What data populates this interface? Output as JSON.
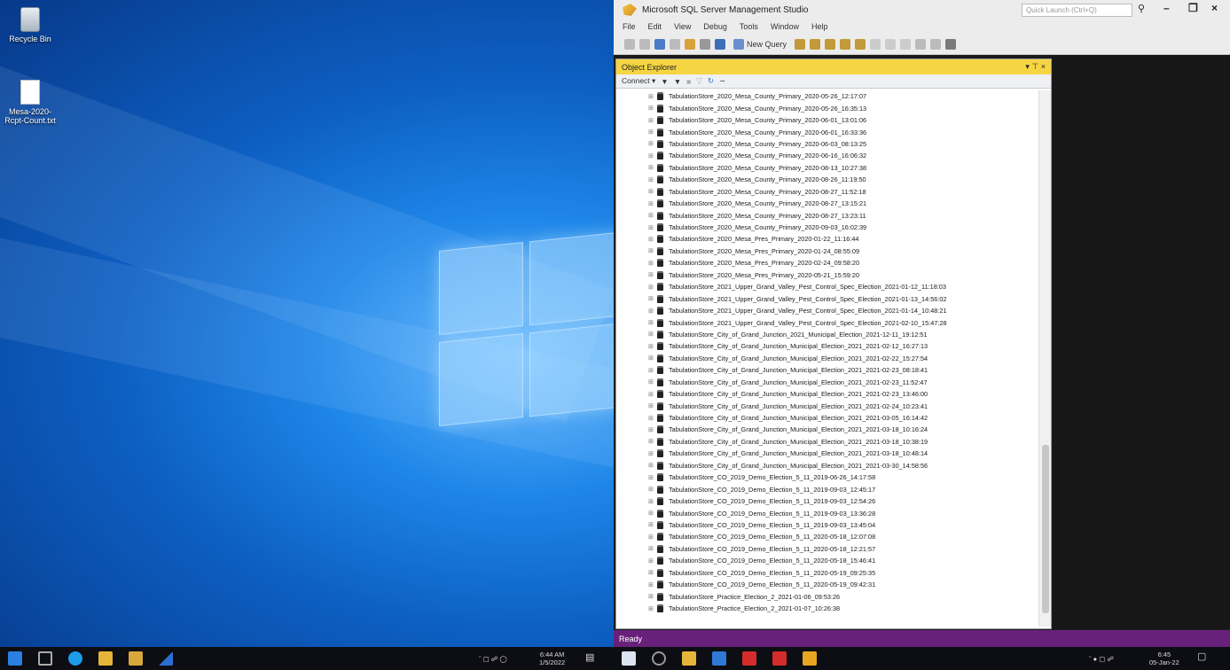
{
  "desktop": {
    "icons": [
      {
        "label": "Recycle Bin",
        "icon": "recycle-bin-icon"
      },
      {
        "label": "Mesa-2020-Rcpt-Count.txt",
        "icon": "text-file-icon"
      }
    ]
  },
  "ssms": {
    "title": "Microsoft SQL Server Management Studio",
    "quick_launch_placeholder": "Quick Launch (Ctrl+Q)",
    "menu": [
      "File",
      "Edit",
      "View",
      "Debug",
      "Tools",
      "Window",
      "Help"
    ],
    "toolbar": {
      "new_query": "New Query"
    },
    "object_explorer": {
      "title": "Object Explorer",
      "pin_controls": "▾ ⊤ ×",
      "connect": "Connect ▾",
      "databases": [
        "TabulationStore_2020_Mesa_County_Primary_2020-05-26_12:17:07",
        "TabulationStore_2020_Mesa_County_Primary_2020-05-26_16:35:13",
        "TabulationStore_2020_Mesa_County_Primary_2020-06-01_13:01:06",
        "TabulationStore_2020_Mesa_County_Primary_2020-06-01_16:33:36",
        "TabulationStore_2020_Mesa_County_Primary_2020-06-03_08:13:25",
        "TabulationStore_2020_Mesa_County_Primary_2020-06-16_16:06:32",
        "TabulationStore_2020_Mesa_County_Primary_2020-08-13_10:27:38",
        "TabulationStore_2020_Mesa_County_Primary_2020-08-26_11:19:50",
        "TabulationStore_2020_Mesa_County_Primary_2020-08-27_11:52:18",
        "TabulationStore_2020_Mesa_County_Primary_2020-08-27_13:15:21",
        "TabulationStore_2020_Mesa_County_Primary_2020-08-27_13:23:11",
        "TabulationStore_2020_Mesa_County_Primary_2020-09-03_16:02:39",
        "TabulationStore_2020_Mesa_Pres_Primary_2020-01-22_11:16:44",
        "TabulationStore_2020_Mesa_Pres_Primary_2020-01-24_08:55:09",
        "TabulationStore_2020_Mesa_Pres_Primary_2020-02-24_09:58:20",
        "TabulationStore_2020_Mesa_Pres_Primary_2020-05-21_15:59:20",
        "TabulationStore_2021_Upper_Grand_Valley_Pest_Control_Spec_Election_2021-01-12_11:18:03",
        "TabulationStore_2021_Upper_Grand_Valley_Pest_Control_Spec_Election_2021-01-13_14:56:02",
        "TabulationStore_2021_Upper_Grand_Valley_Pest_Control_Spec_Election_2021-01-14_10:48:21",
        "TabulationStore_2021_Upper_Grand_Valley_Pest_Control_Spec_Election_2021-02-10_15:47:28",
        "TabulationStore_City_of_Grand_Junction_2021_Municipal_Election_2021-12-11_19:12:51",
        "TabulationStore_City_of_Grand_Junction_Municipal_Election_2021_2021-02-12_16:27:13",
        "TabulationStore_City_of_Grand_Junction_Municipal_Election_2021_2021-02-22_15:27:54",
        "TabulationStore_City_of_Grand_Junction_Municipal_Election_2021_2021-02-23_08:18:41",
        "TabulationStore_City_of_Grand_Junction_Municipal_Election_2021_2021-02-23_11:52:47",
        "TabulationStore_City_of_Grand_Junction_Municipal_Election_2021_2021-02-23_13:46:00",
        "TabulationStore_City_of_Grand_Junction_Municipal_Election_2021_2021-02-24_10:23:41",
        "TabulationStore_City_of_Grand_Junction_Municipal_Election_2021_2021-03-05_16:14:42",
        "TabulationStore_City_of_Grand_Junction_Municipal_Election_2021_2021-03-18_10:16:24",
        "TabulationStore_City_of_Grand_Junction_Municipal_Election_2021_2021-03-18_10:38:19",
        "TabulationStore_City_of_Grand_Junction_Municipal_Election_2021_2021-03-18_10:48:14",
        "TabulationStore_City_of_Grand_Junction_Municipal_Election_2021_2021-03-30_14:58:56",
        "TabulationStore_CO_2019_Demo_Election_5_11_2019-06-26_14:17:58",
        "TabulationStore_CO_2019_Demo_Election_5_11_2019-09-03_12:45:17",
        "TabulationStore_CO_2019_Demo_Election_5_11_2019-09-03_12:54:26",
        "TabulationStore_CO_2019_Demo_Election_5_11_2019-09-03_13:36:28",
        "TabulationStore_CO_2019_Demo_Election_5_11_2019-09-03_13:45:04",
        "TabulationStore_CO_2019_Demo_Election_5_11_2020-05-18_12:07:08",
        "TabulationStore_CO_2019_Demo_Election_5_11_2020-05-18_12:21:57",
        "TabulationStore_CO_2019_Demo_Election_5_11_2020-05-18_15:46:41",
        "TabulationStore_CO_2019_Demo_Election_5_11_2020-05-19_09:25:35",
        "TabulationStore_CO_2019_Demo_Election_5_11_2020-05-19_09:42:31",
        "TabulationStore_Practice_Election_2_2021-01-06_09:53:26",
        "TabulationStore_Practice_Election_2_2021-01-07_10:26:38"
      ]
    },
    "status": "Ready"
  },
  "taskbar_left": {
    "time": "6:44 AM",
    "date": "1/5/2022"
  },
  "taskbar_right": {
    "time": "6:45",
    "date": "05-Jan-22"
  }
}
